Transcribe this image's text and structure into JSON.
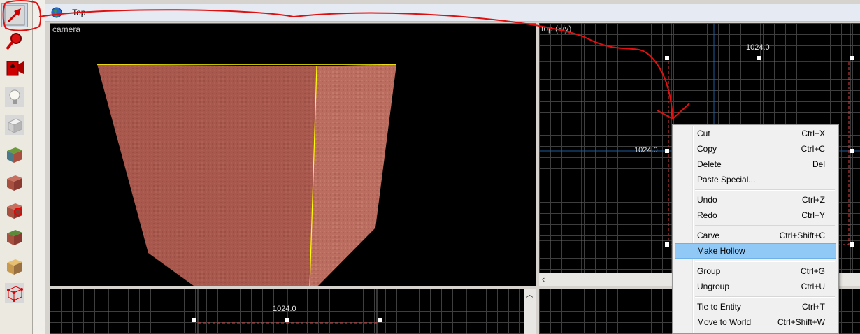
{
  "window": {
    "title": "- Top"
  },
  "toolbar": {
    "tools": [
      {
        "name": "selection-tool",
        "icon": "select-arrow-icon",
        "active": true
      },
      {
        "name": "magnify-tool",
        "icon": "magnify-icon"
      },
      {
        "name": "camera-tool",
        "icon": "camera-icon"
      },
      {
        "name": "entity-tool",
        "icon": "lightbulb-icon"
      },
      {
        "name": "block-tool",
        "icon": "block-icon"
      },
      {
        "name": "texture-app-tool",
        "icon": "texture-icon"
      },
      {
        "name": "apply-texture-tool",
        "icon": "apply-texture-icon"
      },
      {
        "name": "decal-tool",
        "icon": "decal-icon"
      },
      {
        "name": "overlay-tool",
        "icon": "overlay-icon"
      },
      {
        "name": "clip-tool",
        "icon": "clip-icon"
      },
      {
        "name": "vertex-tool",
        "icon": "vertex-icon"
      }
    ]
  },
  "viewports": {
    "camera": {
      "label": "camera"
    },
    "top": {
      "label": "top (x/y)",
      "width_label": "1024.0",
      "height_label": "1024.0"
    },
    "front": {
      "width_label": "1024.0"
    }
  },
  "context_menu": {
    "items": [
      {
        "label": "Cut",
        "shortcut": "Ctrl+X"
      },
      {
        "label": "Copy",
        "shortcut": "Ctrl+C"
      },
      {
        "label": "Delete",
        "shortcut": "Del"
      },
      {
        "label": "Paste Special...",
        "shortcut": ""
      },
      {
        "label": "Undo",
        "shortcut": "Ctrl+Z"
      },
      {
        "label": "Redo",
        "shortcut": "Ctrl+Y"
      },
      {
        "label": "Carve",
        "shortcut": "Ctrl+Shift+C"
      },
      {
        "label": "Make Hollow",
        "shortcut": "",
        "highlighted": true
      },
      {
        "label": "Group",
        "shortcut": "Ctrl+G"
      },
      {
        "label": "Ungroup",
        "shortcut": "Ctrl+U"
      },
      {
        "label": "Tie to Entity",
        "shortcut": "Ctrl+T"
      },
      {
        "label": "Move to World",
        "shortcut": "Ctrl+Shift+W"
      }
    ]
  },
  "colors": {
    "annotation": "#e01010",
    "brush_texture": "#a8584c",
    "selection_outline": "#ffff00",
    "menu_highlight": "#90c8f6"
  }
}
